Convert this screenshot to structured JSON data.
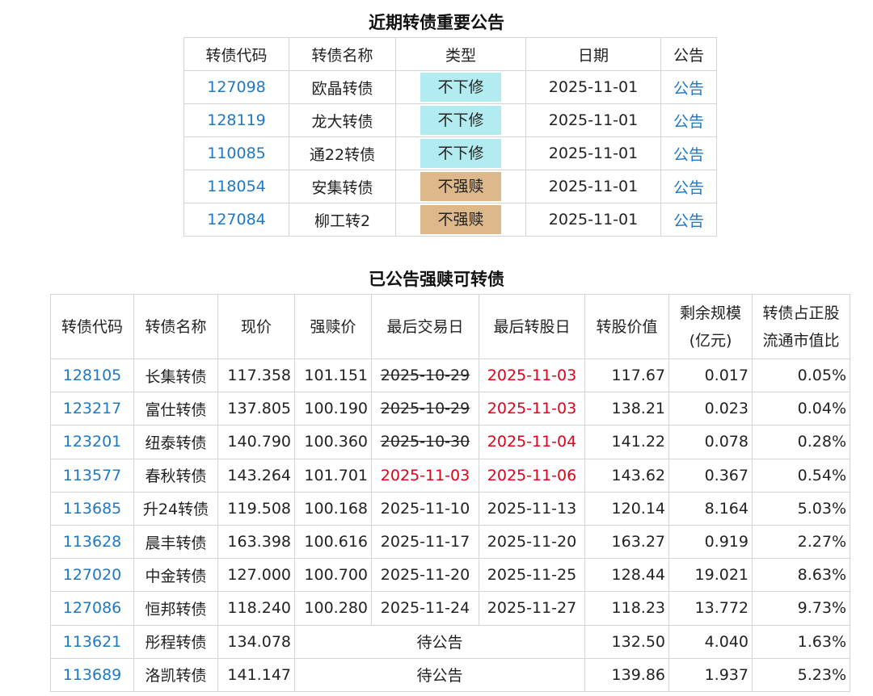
{
  "colors": {
    "link": "#1f78c1",
    "red": "#e3001b",
    "badge_no_revise": "#b3ecf0",
    "badge_no_redeem": "#dcb88a",
    "border": "#d4d4d4"
  },
  "announcements": {
    "title": "近期转债重要公告",
    "headers": [
      "转债代码",
      "转债名称",
      "类型",
      "日期",
      "公告"
    ],
    "rows": [
      {
        "code": "127098",
        "name": "欧晶转债",
        "type": "不下修",
        "type_color": "#b3ecf0",
        "date": "2025-11-01",
        "link": "公告"
      },
      {
        "code": "128119",
        "name": "龙大转债",
        "type": "不下修",
        "type_color": "#b3ecf0",
        "date": "2025-11-01",
        "link": "公告"
      },
      {
        "code": "110085",
        "name": "通22转债",
        "type": "不下修",
        "type_color": "#b3ecf0",
        "date": "2025-11-01",
        "link": "公告"
      },
      {
        "code": "118054",
        "name": "安集转债",
        "type": "不强赎",
        "type_color": "#dcb88a",
        "date": "2025-11-01",
        "link": "公告"
      },
      {
        "code": "127084",
        "name": "柳工转2",
        "type": "不强赎",
        "type_color": "#dcb88a",
        "date": "2025-11-01",
        "link": "公告"
      }
    ]
  },
  "redemption": {
    "title": "已公告强赎可转债",
    "headers": [
      {
        "l1": "转债代码"
      },
      {
        "l1": "转债名称"
      },
      {
        "l1": "现价"
      },
      {
        "l1": "强赎价"
      },
      {
        "l1": "最后交易日"
      },
      {
        "l1": "最后转股日"
      },
      {
        "l1": "转股价值"
      },
      {
        "l1": "剩余规模",
        "l2": "(亿元)"
      },
      {
        "l1": "转债占正股",
        "l2": "流通市值比"
      }
    ],
    "rows": [
      {
        "code": "128105",
        "name": "长集转债",
        "price": "117.358",
        "redeem_price": "101.151",
        "last_trade": "2025-10-29",
        "last_trade_style": "strike",
        "last_convert": "2025-11-03",
        "last_convert_style": "red",
        "conv_value": "117.67",
        "remaining": "0.017",
        "ratio": "0.05%"
      },
      {
        "code": "123217",
        "name": "富仕转债",
        "price": "137.805",
        "redeem_price": "100.190",
        "last_trade": "2025-10-29",
        "last_trade_style": "strike",
        "last_convert": "2025-11-03",
        "last_convert_style": "red",
        "conv_value": "138.21",
        "remaining": "0.023",
        "ratio": "0.04%"
      },
      {
        "code": "123201",
        "name": "纽泰转债",
        "price": "140.790",
        "redeem_price": "100.360",
        "last_trade": "2025-10-30",
        "last_trade_style": "strike",
        "last_convert": "2025-11-04",
        "last_convert_style": "red",
        "conv_value": "141.22",
        "remaining": "0.078",
        "ratio": "0.28%"
      },
      {
        "code": "113577",
        "name": "春秋转债",
        "price": "143.264",
        "redeem_price": "101.701",
        "last_trade": "2025-11-03",
        "last_trade_style": "red",
        "last_convert": "2025-11-06",
        "last_convert_style": "red",
        "conv_value": "143.62",
        "remaining": "0.367",
        "ratio": "0.54%"
      },
      {
        "code": "113685",
        "name": "升24转债",
        "price": "119.508",
        "redeem_price": "100.168",
        "last_trade": "2025-11-10",
        "last_trade_style": "normal",
        "last_convert": "2025-11-13",
        "last_convert_style": "normal",
        "conv_value": "120.14",
        "remaining": "8.164",
        "ratio": "5.03%"
      },
      {
        "code": "113628",
        "name": "晨丰转债",
        "price": "163.398",
        "redeem_price": "100.616",
        "last_trade": "2025-11-17",
        "last_trade_style": "normal",
        "last_convert": "2025-11-20",
        "last_convert_style": "normal",
        "conv_value": "163.27",
        "remaining": "0.919",
        "ratio": "2.27%"
      },
      {
        "code": "127020",
        "name": "中金转债",
        "price": "127.000",
        "redeem_price": "100.700",
        "last_trade": "2025-11-20",
        "last_trade_style": "normal",
        "last_convert": "2025-11-25",
        "last_convert_style": "normal",
        "conv_value": "128.44",
        "remaining": "19.021",
        "ratio": "8.63%"
      },
      {
        "code": "127086",
        "name": "恒邦转债",
        "price": "118.240",
        "redeem_price": "100.280",
        "last_trade": "2025-11-24",
        "last_trade_style": "normal",
        "last_convert": "2025-11-27",
        "last_convert_style": "normal",
        "conv_value": "118.23",
        "remaining": "13.772",
        "ratio": "9.73%"
      },
      {
        "code": "113621",
        "name": "彤程转债",
        "price": "134.078",
        "pending": "待公告",
        "conv_value": "132.50",
        "remaining": "4.040",
        "ratio": "1.63%"
      },
      {
        "code": "113689",
        "name": "洛凯转债",
        "price": "141.147",
        "pending": "待公告",
        "conv_value": "139.86",
        "remaining": "1.937",
        "ratio": "5.23%"
      }
    ]
  }
}
